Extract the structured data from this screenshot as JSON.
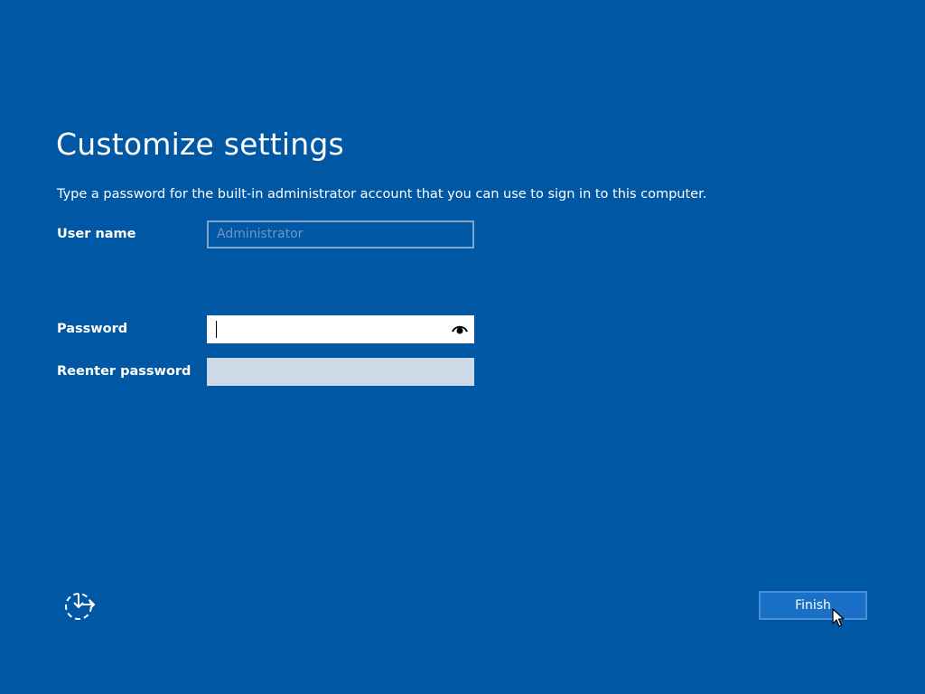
{
  "page": {
    "title": "Customize settings",
    "instructions": "Type a password for the built-in administrator account that you can use to sign in to this computer."
  },
  "form": {
    "username_label": "User name",
    "username_value": "Administrator",
    "password_label": "Password",
    "password_value": "",
    "reenter_label": "Reenter password",
    "reenter_value": ""
  },
  "icons": {
    "reveal": "eye-icon",
    "accessibility": "ease-of-access-icon",
    "pointer": "mouse-pointer-icon"
  },
  "footer": {
    "finish_label": "Finish"
  },
  "colors": {
    "background": "#0057a3",
    "button": "#1a6fc7",
    "button_border": "#4a8fd6",
    "disabled_field": "#cdd9e6"
  }
}
